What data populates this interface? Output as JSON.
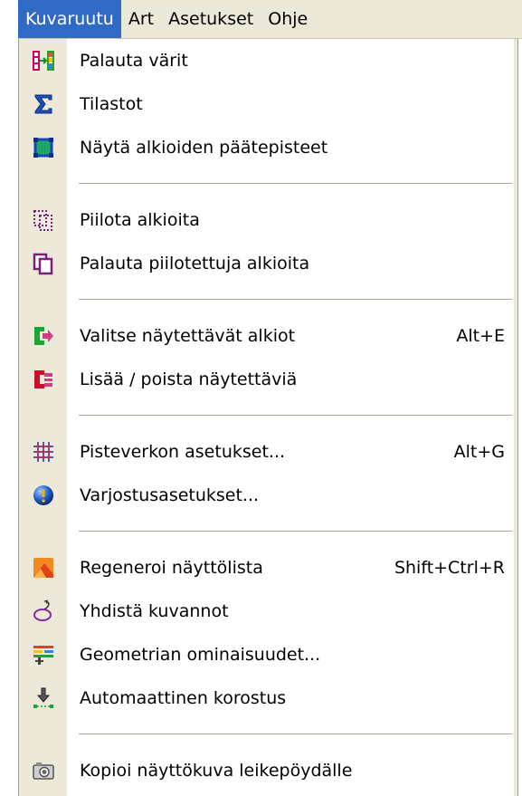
{
  "menubar": {
    "items": [
      {
        "label": "Kuvaruutu"
      },
      {
        "label": "Art"
      },
      {
        "label": "Asetukset"
      },
      {
        "label": "Ohje"
      }
    ]
  },
  "menu": {
    "group1": [
      {
        "label": "Palauta värit",
        "icon": "restore-colors-icon"
      },
      {
        "label": "Tilastot",
        "icon": "sigma-icon"
      },
      {
        "label": "Näytä alkioiden päätepisteet",
        "icon": "endpoints-icon"
      }
    ],
    "group2": [
      {
        "label": "Piilota alkioita",
        "icon": "hide-elements-icon"
      },
      {
        "label": "Palauta piilotettuja alkioita",
        "icon": "restore-hidden-icon"
      }
    ],
    "group3": [
      {
        "label": "Valitse näytettävät alkiot",
        "shortcut": "Alt+E",
        "icon": "select-display-icon"
      },
      {
        "label": "Lisää / poista näytettäviä",
        "icon": "add-remove-display-icon"
      }
    ],
    "group4": [
      {
        "label": "Pisteverkon asetukset...",
        "shortcut": "Alt+G",
        "icon": "grid-icon"
      },
      {
        "label": "Varjostusasetukset...",
        "icon": "shading-icon"
      }
    ],
    "group5": [
      {
        "label": "Regeneroi näyttölista",
        "shortcut": "Shift+Ctrl+R",
        "icon": "regenerate-icon"
      },
      {
        "label": "Yhdistä kuvannot",
        "icon": "merge-views-icon"
      },
      {
        "label": "Geometrian ominaisuudet...",
        "icon": "geometry-properties-icon"
      },
      {
        "label": "Automaattinen korostus",
        "icon": "auto-highlight-icon"
      }
    ],
    "group6": [
      {
        "label": "Kopioi näyttökuva leikepöydälle",
        "icon": "camera-icon"
      }
    ]
  },
  "colors": {
    "highlight": "#316ac5",
    "menubar_bg": "#ece9d8",
    "gutter_bg": "#ece9d8"
  }
}
